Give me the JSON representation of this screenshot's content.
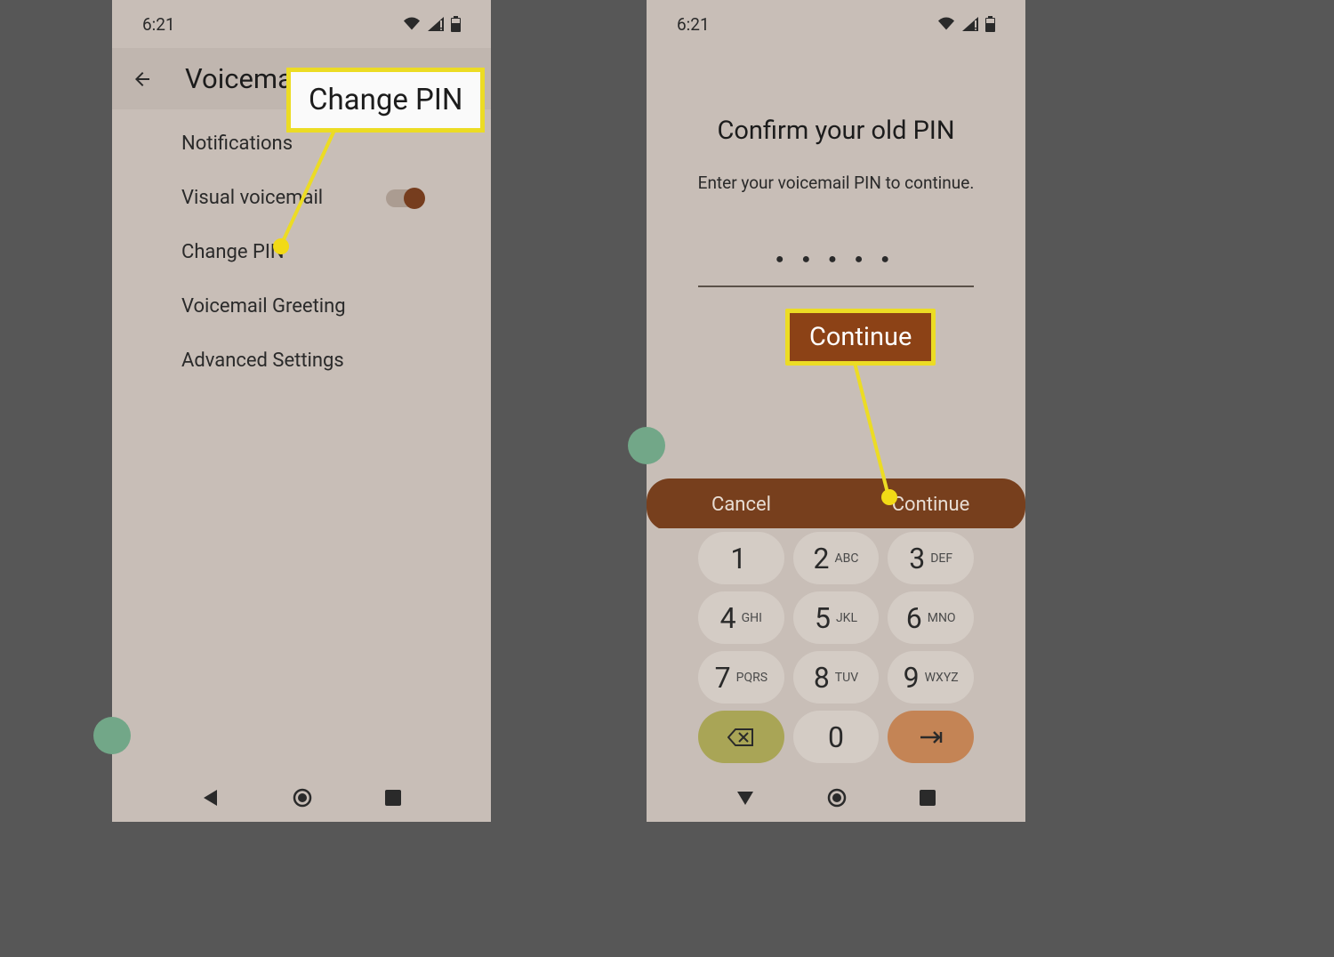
{
  "status": {
    "time": "6:21"
  },
  "left": {
    "header_title": "Voicemail",
    "items": [
      {
        "label": "Notifications"
      },
      {
        "label": "Visual voicemail",
        "toggle": true
      },
      {
        "label": "Change PIN"
      },
      {
        "label": "Voicemail Greeting"
      },
      {
        "label": "Advanced Settings"
      }
    ],
    "callout_label": "Change PIN"
  },
  "right": {
    "title": "Confirm your old PIN",
    "subtitle": "Enter your voicemail PIN to continue.",
    "pin_masked": "● ● ● ● ●",
    "cancel_label": "Cancel",
    "continue_label": "Continue",
    "callout_label": "Continue"
  },
  "keypad": {
    "k1": {
      "d": "1",
      "s": ""
    },
    "k2": {
      "d": "2",
      "s": "ABC"
    },
    "k3": {
      "d": "3",
      "s": "DEF"
    },
    "k4": {
      "d": "4",
      "s": "GHI"
    },
    "k5": {
      "d": "5",
      "s": "JKL"
    },
    "k6": {
      "d": "6",
      "s": "MNO"
    },
    "k7": {
      "d": "7",
      "s": "PQRS"
    },
    "k8": {
      "d": "8",
      "s": "TUV"
    },
    "k9": {
      "d": "9",
      "s": "WXYZ"
    },
    "k0": {
      "d": "0",
      "s": ""
    }
  }
}
